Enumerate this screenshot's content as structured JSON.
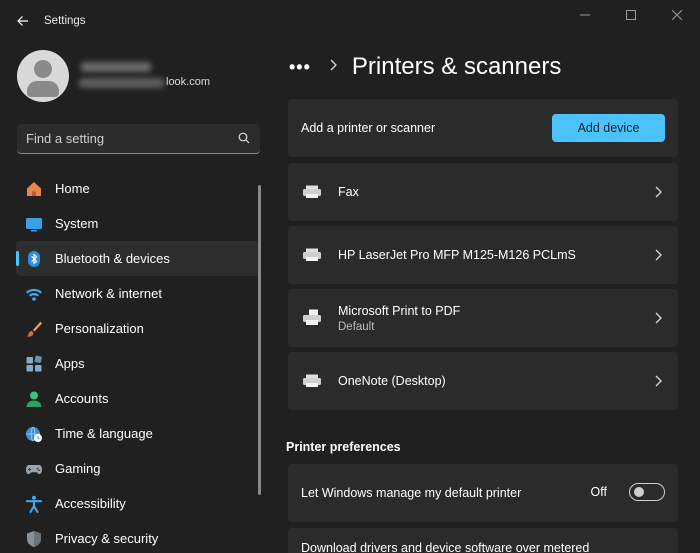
{
  "window": {
    "title": "Settings"
  },
  "profile": {
    "email_suffix": "look.com"
  },
  "search": {
    "placeholder": "Find a setting"
  },
  "sidebar": {
    "items": [
      {
        "label": "Home",
        "icon": "home-icon",
        "active": false
      },
      {
        "label": "System",
        "icon": "system-monitor-icon",
        "active": false
      },
      {
        "label": "Bluetooth & devices",
        "icon": "bluetooth-icon",
        "active": true
      },
      {
        "label": "Network & internet",
        "icon": "wifi-icon",
        "active": false
      },
      {
        "label": "Personalization",
        "icon": "paintbrush-icon",
        "active": false
      },
      {
        "label": "Apps",
        "icon": "apps-icon",
        "active": false
      },
      {
        "label": "Accounts",
        "icon": "person-icon",
        "active": false
      },
      {
        "label": "Time & language",
        "icon": "globe-clock-icon",
        "active": false
      },
      {
        "label": "Gaming",
        "icon": "gamepad-icon",
        "active": false
      },
      {
        "label": "Accessibility",
        "icon": "accessibility-icon",
        "active": false
      },
      {
        "label": "Privacy & security",
        "icon": "shield-icon",
        "active": false
      }
    ]
  },
  "main": {
    "breadcrumb_more": "•••",
    "title": "Printers & scanners",
    "add_card": {
      "label": "Add a printer or scanner",
      "button": "Add device"
    },
    "devices": [
      {
        "name": "Fax",
        "sub": ""
      },
      {
        "name": "HP LaserJet Pro MFP M125-M126 PCLmS",
        "sub": ""
      },
      {
        "name": "Microsoft Print to PDF",
        "sub": "Default"
      },
      {
        "name": "OneNote (Desktop)",
        "sub": ""
      }
    ],
    "preferences": {
      "title": "Printer preferences",
      "default_printer_label": "Let Windows manage my default printer",
      "default_printer_state": "Off",
      "drivers_label": "Download drivers and device software over metered"
    }
  },
  "colors": {
    "accent": "#4cc2ff",
    "background": "#202020",
    "card": "#2b2b2b"
  }
}
